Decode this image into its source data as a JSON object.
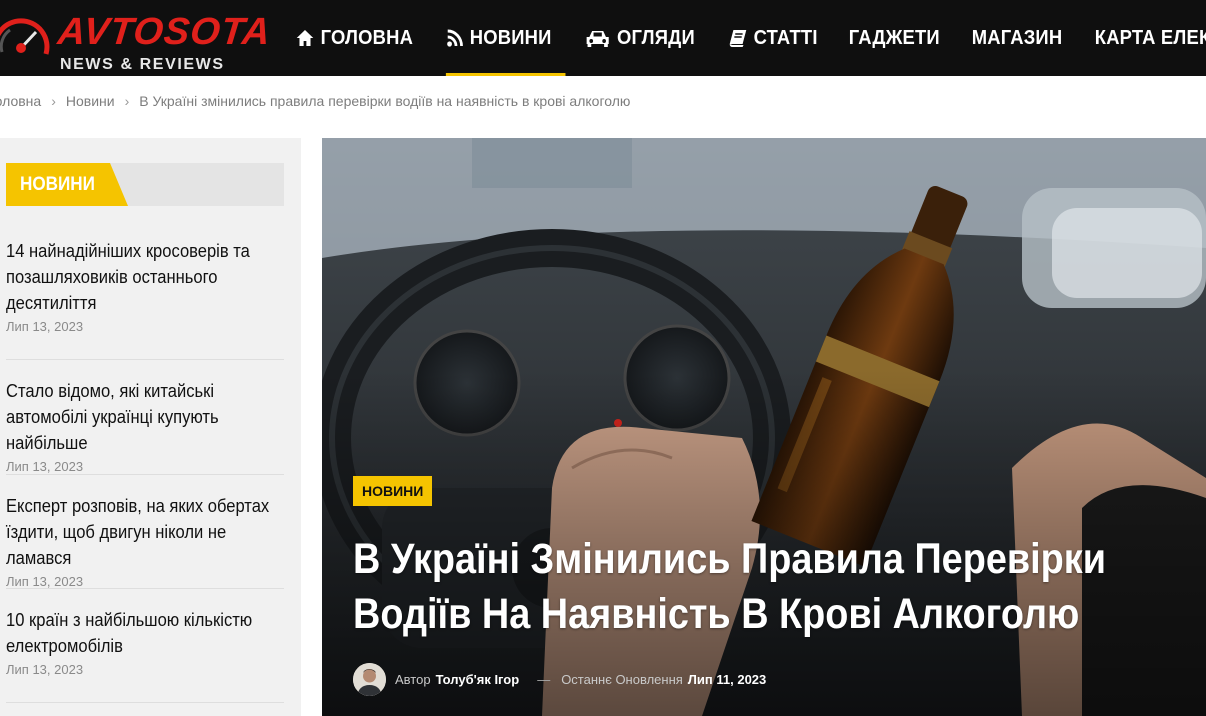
{
  "header": {
    "logo_title": "AVTOSOTA",
    "logo_subtitle": "NEWS & REVIEWS",
    "nav": [
      {
        "label": "Головна",
        "icon": "home-icon"
      },
      {
        "label": "Новини",
        "icon": "rss-icon"
      },
      {
        "label": "Огляди",
        "icon": "car-icon"
      },
      {
        "label": "Статті",
        "icon": "book-icon"
      },
      {
        "label": "Гаджети",
        "icon": ""
      },
      {
        "label": "Магазин",
        "icon": ""
      },
      {
        "label": "Карта електрозапр",
        "icon": ""
      }
    ],
    "active_nav": "Новини"
  },
  "breadcrumb": {
    "items": [
      "Головна",
      "Новини",
      "В Україні змінились правила перевірки водіїв на наявність в крові алкоголю"
    ],
    "separator": "›"
  },
  "sidebar": {
    "heading": "Новини",
    "items": [
      {
        "title": "14 найнадійніших кросоверів та позашляховиків останнього десятиліття",
        "date": "Лип 13, 2023"
      },
      {
        "title": "Стало відомо, які китайські автомобілі українці купують найбільше",
        "date": "Лип 13, 2023"
      },
      {
        "title": "Експерт розповів, на яких обертах їздити, щоб двигун ніколи не ламався",
        "date": "Лип 13, 2023"
      },
      {
        "title": "10 країн з найбільшою кількістю електромобілів",
        "date": "Лип 13, 2023"
      }
    ]
  },
  "article": {
    "category": "Новини",
    "title": "В Україні Змінились Правила Перевірки Водіїв На Наявність В Крові Алкоголю",
    "author_label": "Автор",
    "author_name": "Толуб'як Ігор",
    "dash": "—",
    "updated_label": "Останнє Оновлення",
    "updated_date": "Лип 11, 2023"
  },
  "colors": {
    "accent": "#f5c400",
    "brand_red": "#e0201b",
    "header_bg": "#0f0f0f",
    "sidebar_bg": "#f1f1f1"
  }
}
